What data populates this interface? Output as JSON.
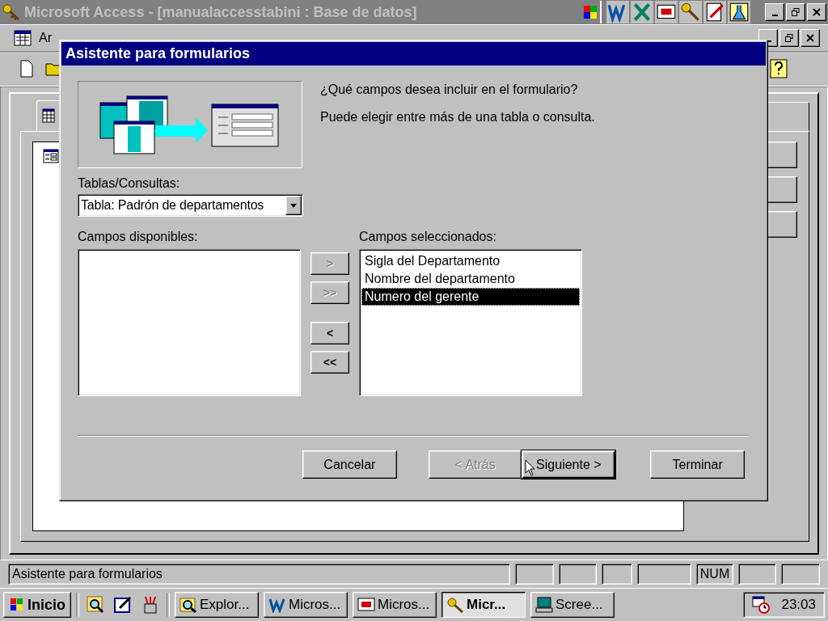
{
  "app_window": {
    "title": "Microsoft Access - [manualaccesstabini : Base de datos]"
  },
  "menu_bar": {
    "items": [
      {
        "label": "Ar"
      }
    ]
  },
  "dialog": {
    "title": "Asistente para formularios",
    "prompts": [
      "¿Qué campos desea incluir en el formulario?",
      "Puede elegir entre más de una tabla o consulta."
    ],
    "source_label": "Tablas/Consultas:",
    "source_value": "Tabla: Padrón de departamentos",
    "available_label": "Campos disponibles:",
    "selected_label": "Campos seleccionados:",
    "selected_fields": [
      {
        "label": "Sigla del Departamento",
        "selected": false
      },
      {
        "label": "Nombre del departamento",
        "selected": false
      },
      {
        "label": "Numero del gerente",
        "selected": true
      }
    ],
    "move_buttons": [
      {
        "label": ">",
        "disabled": true
      },
      {
        "label": ">>",
        "disabled": true
      },
      {
        "label": "<",
        "disabled": false
      },
      {
        "label": "<<",
        "disabled": false
      }
    ],
    "buttons": [
      {
        "label": "Cancelar",
        "disabled": false,
        "default": false
      },
      {
        "label": "< Atrás",
        "disabled": true,
        "default": false
      },
      {
        "label": "Siguiente >",
        "disabled": false,
        "default": true
      },
      {
        "label": "Terminar",
        "disabled": false,
        "default": false
      }
    ]
  },
  "status_bar": {
    "text": "Asistente para formularios",
    "indicators": [
      {
        "label": "NUM"
      }
    ]
  },
  "taskbar": {
    "start": "Inicio",
    "tasks": [
      {
        "label": "Explor...",
        "kind": "explorer",
        "selected": false
      },
      {
        "label": "Micros...",
        "kind": "word",
        "selected": false
      },
      {
        "label": "Micros...",
        "kind": "presentation",
        "selected": false
      },
      {
        "label": "Micr...",
        "kind": "access",
        "selected": true
      },
      {
        "label": "Scree...",
        "kind": "computer",
        "selected": false
      }
    ],
    "clock": "23:03"
  }
}
